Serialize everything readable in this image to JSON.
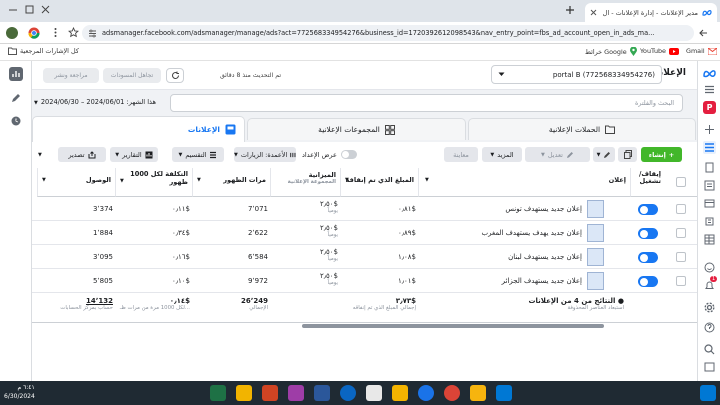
{
  "browser": {
    "tab_title": "مدير الإعلانات - إدارة الإعلانات - ال",
    "url": "adsmanager.facebook.com/adsmanager/manage/ads?act=772568334954276&business_id=1720392612098543&nav_entry_point=fbs_ad_account_open_in_ads_ma...",
    "bookmarks": {
      "gmail": "Gmail",
      "youtube": "YouTube",
      "maps": "خرائط Google",
      "all": "كل الإشارات المرجعية"
    }
  },
  "header": {
    "title": "الإعلانات",
    "account": "portal B (772568334954276)",
    "updated": "تم التحديث منذ 8 دقائق",
    "discard": "تجاهل المسودات",
    "review": "مراجعة ونشر"
  },
  "search": {
    "placeholder": "البحث والفلترة",
    "date_range": "هذا الشهر: 2024/06/01 – 2024/06/30"
  },
  "tabs": {
    "campaigns": "الحملات الإعلانية",
    "adsets": "المجموعات الإعلانية",
    "ads": "الإعلانات"
  },
  "toolbar": {
    "create": "إنشاء",
    "edit": "تعديل",
    "more": "المزيد",
    "rules": "معاينة",
    "show_setup": "عرض الإعداد",
    "columns": "الأعمدة: الزيارات",
    "breakdown": "التقسيم",
    "reports": "التقارير",
    "export": "تصدير"
  },
  "columns": {
    "onoff": "إيقاف/تشغيل",
    "ad": "إعلان",
    "spent": "المبلغ الذي تم إنفاقه",
    "budget": "الميزانية",
    "budget_sub": "المجموعة الإعلانية",
    "impressions": "مرات الظهور",
    "cpm": "التكلفة لكل 1000 ظهور",
    "reach": "الوصول"
  },
  "rows": [
    {
      "name": "إعلان جديد يستهدف تونس",
      "spent": "‏٠٫٨١$",
      "budget": "‏٢٫٥٠$",
      "budget_sub": "يومياً",
      "impressions": "7٬071",
      "cpm": "‏٠٫١١$",
      "reach": "3٬374"
    },
    {
      "name": "إعلان جديد يهدف يستهدف المغرب",
      "spent": "‏٠٫٨٩$",
      "budget": "‏٢٫٥٠$",
      "budget_sub": "يومياً",
      "impressions": "2٬622",
      "cpm": "‏٠٫٣٤$",
      "reach": "1٬884"
    },
    {
      "name": "إعلان جديد يستهدف لبنان",
      "spent": "‏١٫٠٨$",
      "budget": "‏٢٫٥٠$",
      "budget_sub": "يومياً",
      "impressions": "6٬584",
      "cpm": "‏٠٫١٦$",
      "reach": "3٬095"
    },
    {
      "name": "إعلان جديد يستهدف الجزائر",
      "spent": "‏١٫٠١$",
      "budget": "‏٢٫٥٠$",
      "budget_sub": "يومياً",
      "impressions": "9٬972",
      "cpm": "‏٠٫١٠$",
      "reach": "5٬805"
    }
  ],
  "totals": {
    "label": "النتائج من 4 من الإعلانات",
    "label_sub": "استبعاد العناصر المحذوفة",
    "spent": "‏٣٫٧٣$",
    "spent_sub": "إجمالي المبلغ الذي تم إنفاقه",
    "impressions": "26٬249",
    "impressions_sub": "الإجمالي",
    "cpm": "‏٠٫١٤$",
    "cpm_sub": "لكل 1000 مرة من مرات ظـ...",
    "reach": "14٬132",
    "reach_sub": "حساب بمركز الحسابات"
  },
  "taskbar": {
    "time": "٦:٤١ م",
    "date": "6/30/2024",
    "notifications": "1"
  },
  "colors": {
    "accent": "#1877f2",
    "create_green": "#42b72a",
    "avatar": "#e41e3f"
  }
}
